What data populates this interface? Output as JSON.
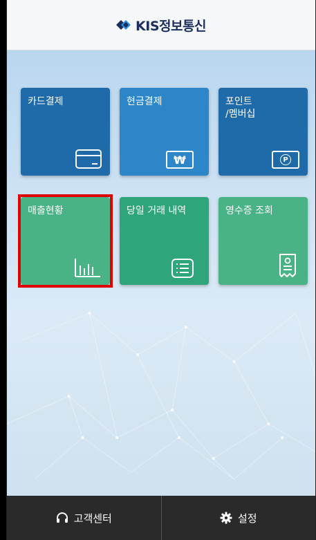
{
  "header": {
    "brand_text": "KIS정보통신",
    "brand_color": "#1b2f5e"
  },
  "menu": {
    "tiles": [
      {
        "label": "카드결제",
        "icon": "card-icon",
        "color": "#1f6aa8"
      },
      {
        "label": "현금결제",
        "icon": "won-icon",
        "color": "#2d86c8"
      },
      {
        "label": "포인트\n/멤버십",
        "icon": "point-icon",
        "color": "#1f6aa8"
      },
      {
        "label": "매출현황",
        "icon": "bar-chart-icon",
        "color": "#4ab385",
        "selected": true
      },
      {
        "label": "당일 거래 내역",
        "icon": "list-icon",
        "color": "#2fa57a"
      },
      {
        "label": "영수증 조회",
        "icon": "receipt-icon",
        "color": "#4ab385"
      }
    ],
    "won_symbol": "₩",
    "point_symbol": "P"
  },
  "bottom_nav": {
    "support_label": "고객센터",
    "settings_label": "설정"
  },
  "colors": {
    "highlight": "#e00000",
    "bottom_bar": "#2a2a2a"
  }
}
